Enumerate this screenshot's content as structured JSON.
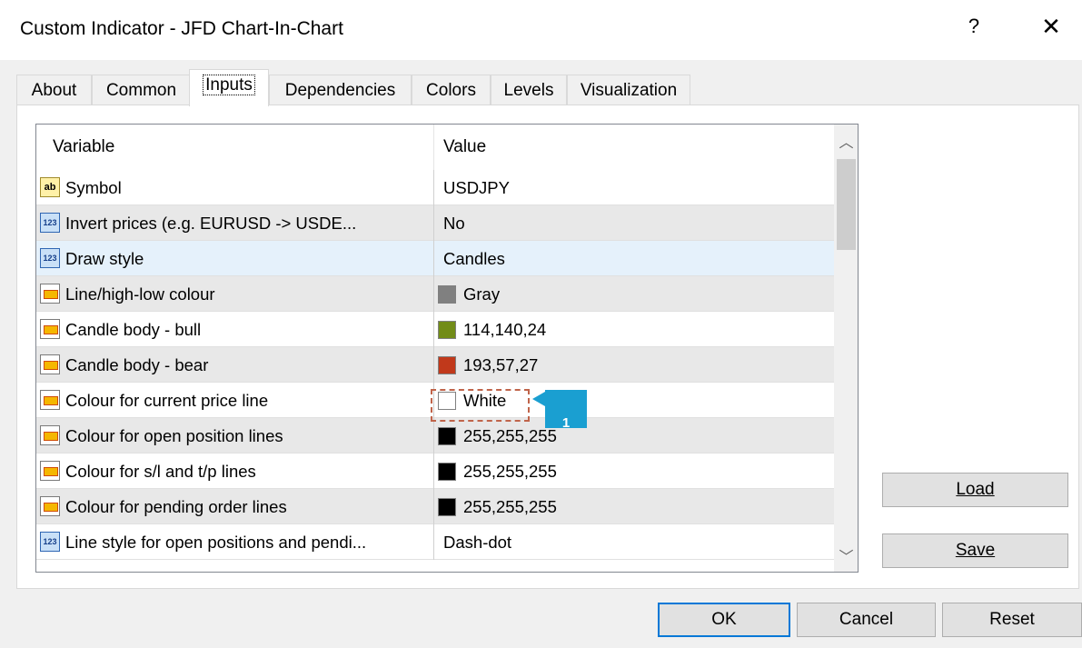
{
  "window": {
    "title": "Custom Indicator - JFD Chart-In-Chart",
    "help_label": "?",
    "close_label": "✕"
  },
  "tabs": [
    {
      "label": "About"
    },
    {
      "label": "Common"
    },
    {
      "label": "Inputs",
      "active": true
    },
    {
      "label": "Dependencies"
    },
    {
      "label": "Colors"
    },
    {
      "label": "Levels"
    },
    {
      "label": "Visualization"
    }
  ],
  "grid": {
    "headers": {
      "variable": "Variable",
      "value": "Value"
    },
    "rows": [
      {
        "icon": "ab-icon",
        "name": "Symbol",
        "value": "USDJPY"
      },
      {
        "icon": "123-icon",
        "name": "Invert prices (e.g. EURUSD -> USDE...",
        "value": "No"
      },
      {
        "icon": "123-icon",
        "name": "Draw style",
        "value": "Candles",
        "selected": true
      },
      {
        "icon": "color-icon",
        "name": "Line/high-low colour",
        "value": "Gray",
        "swatch": "#808080"
      },
      {
        "icon": "color-icon",
        "name": "Candle body - bull",
        "value": "114,140,24",
        "swatch": "#728c18"
      },
      {
        "icon": "color-icon",
        "name": "Candle body - bear",
        "value": "193,57,27",
        "swatch": "#c1391b"
      },
      {
        "icon": "color-icon",
        "name": "Colour for current price line",
        "value": "White",
        "swatch": "#ffffff"
      },
      {
        "icon": "color-icon",
        "name": "Colour for open position lines",
        "value": "255,255,255",
        "swatch": "#000000"
      },
      {
        "icon": "color-icon",
        "name": "Colour for s/l and t/p lines",
        "value": "255,255,255",
        "swatch": "#000000"
      },
      {
        "icon": "color-icon",
        "name": "Colour for pending order lines",
        "value": "255,255,255",
        "swatch": "#000000"
      },
      {
        "icon": "123-icon",
        "name": "Line style for open positions and pendi...",
        "value": "Dash-dot"
      }
    ]
  },
  "callout": {
    "number": "1"
  },
  "side_buttons": {
    "load": "Load",
    "save": "Save"
  },
  "footer_buttons": {
    "ok": "OK",
    "cancel": "Cancel",
    "reset": "Reset"
  },
  "colors": {
    "accent": "#1a9fd1",
    "selected_row": "#e5f1fb",
    "default_button_border": "#0078d7"
  }
}
